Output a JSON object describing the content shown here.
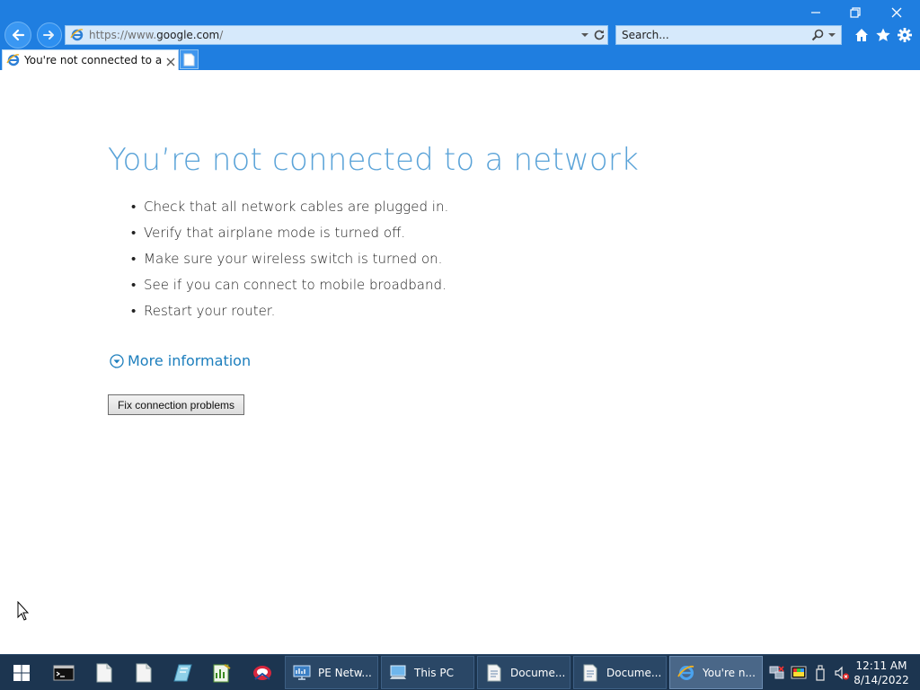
{
  "browser": {
    "address": {
      "scheme": "https://www.",
      "domain": "google.com",
      "path": "/"
    },
    "search": {
      "placeholder": "Search..."
    },
    "tab": {
      "title": "You're not connected to a n..."
    }
  },
  "page": {
    "title": "You’re not connected to a network",
    "tips": [
      "Check that all network cables are plugged in.",
      "Verify that airplane mode is turned off.",
      "Make sure your wireless switch is turned on.",
      "See if you can connect to mobile broadband.",
      "Restart your router."
    ],
    "more_info": "More information",
    "fix_button": "Fix connection problems"
  },
  "taskbar": {
    "buttons": [
      {
        "label": "PE Netw..."
      },
      {
        "label": "This PC"
      },
      {
        "label": "Docume..."
      },
      {
        "label": "Docume..."
      },
      {
        "label": "You're n..."
      }
    ],
    "clock": {
      "time": "12:11 AM",
      "date": "8/14/2022"
    }
  },
  "colors": {
    "titlebar": "#1f7ee0",
    "heading": "#5aa3d8",
    "link": "#1c7ebd",
    "taskbar": "#1c3550"
  }
}
